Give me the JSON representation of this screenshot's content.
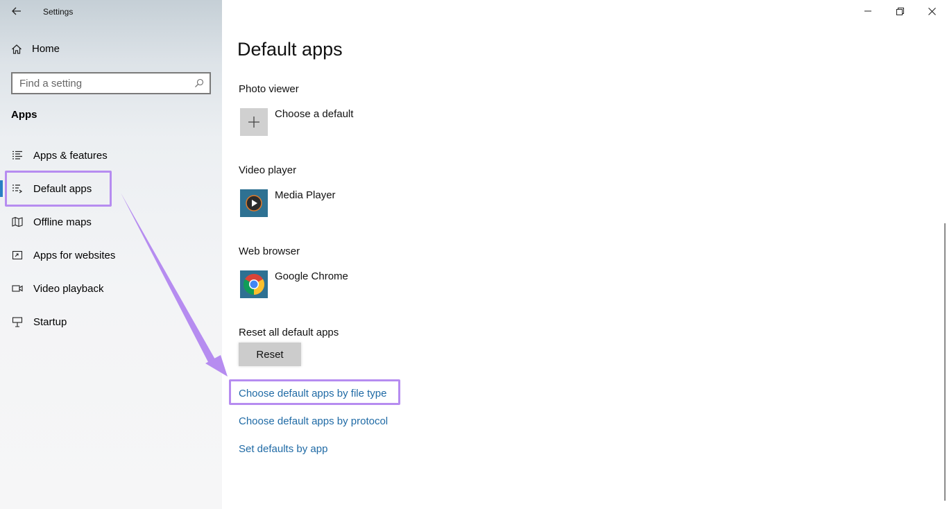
{
  "window": {
    "title": "Settings",
    "controls": {
      "minimize": "—",
      "restore": "❐",
      "close": "✕"
    }
  },
  "sidebar": {
    "home_label": "Home",
    "search": {
      "placeholder": "Find a setting",
      "value": ""
    },
    "section_title": "Apps",
    "items": [
      {
        "label": "Apps & features",
        "icon": "list-icon"
      },
      {
        "label": "Default apps",
        "icon": "default-apps-icon",
        "active": true
      },
      {
        "label": "Offline maps",
        "icon": "map-icon"
      },
      {
        "label": "Apps for websites",
        "icon": "web-app-icon"
      },
      {
        "label": "Video playback",
        "icon": "video-icon"
      },
      {
        "label": "Startup",
        "icon": "startup-icon"
      }
    ]
  },
  "main": {
    "title": "Default apps",
    "groups": [
      {
        "label": "Photo viewer",
        "app": "Choose a default",
        "icon": "plus-icon"
      },
      {
        "label": "Video player",
        "app": "Media Player",
        "icon": "media-player-icon"
      },
      {
        "label": "Web browser",
        "app": "Google Chrome",
        "icon": "chrome-icon"
      }
    ],
    "reset": {
      "label": "Reset all default apps",
      "button": "Reset"
    },
    "links": [
      "Choose default apps by file type",
      "Choose default apps by protocol",
      "Set defaults by app"
    ]
  },
  "colors": {
    "accent": "#2a7fc4",
    "link": "#1f6aa5",
    "highlight": "#b68cf0",
    "reset_button": "#cccccc"
  }
}
